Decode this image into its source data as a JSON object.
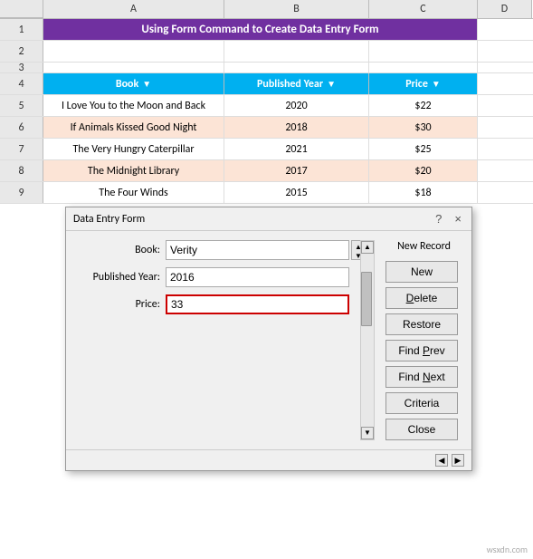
{
  "title": "Using Form Command to Create Data Entry Form",
  "columns": {
    "a": "A",
    "b": "B",
    "c": "C",
    "d": "D"
  },
  "row_numbers": [
    "1",
    "2",
    "3",
    "4",
    "5",
    "6",
    "7",
    "8",
    "9"
  ],
  "header": {
    "book": "Book",
    "published_year": "Published Year",
    "price": "Price"
  },
  "rows": [
    {
      "book": "I Love You to the Moon and Back",
      "year": "2020",
      "price": "$22"
    },
    {
      "book": "If Animals Kissed Good Night",
      "year": "2018",
      "price": "$30"
    },
    {
      "book": "The Very Hungry Caterpillar",
      "year": "2021",
      "price": "$25"
    },
    {
      "book": "The Midnight Library",
      "year": "2017",
      "price": "$20"
    },
    {
      "book": "The Four Winds",
      "year": "2015",
      "price": "$18"
    }
  ],
  "dialog": {
    "title": "Data Entry Form",
    "ctrl_question": "?",
    "ctrl_close": "×",
    "new_record_label": "New Record",
    "fields": {
      "book_label": "Book:",
      "book_value": "Verity",
      "year_label": "Published Year:",
      "year_value": "2016",
      "price_label": "Price:",
      "price_value": "33"
    },
    "buttons": {
      "new": "New",
      "delete": "Delete",
      "restore": "Restore",
      "find_prev": "Find Prev",
      "find_next": "Find Next",
      "criteria": "Criteria",
      "close": "Close"
    }
  },
  "watermark": "wsxdn.com"
}
